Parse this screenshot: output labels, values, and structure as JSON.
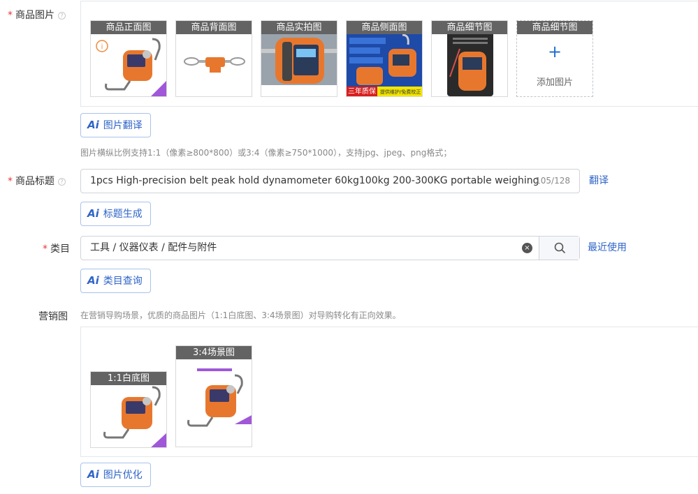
{
  "product_images": {
    "label": "商品图片",
    "required_mark": "*",
    "help_icon": "question-circle-icon",
    "cards": [
      {
        "caption": "商品正面图"
      },
      {
        "caption": "商品背面图"
      },
      {
        "caption": "商品实拍图"
      },
      {
        "caption": "商品侧面图"
      },
      {
        "caption": "商品细节图"
      }
    ],
    "add_card": {
      "caption": "商品细节图",
      "plus": "+",
      "text": "添加图片"
    },
    "ai_button": {
      "icon": "Ai",
      "label": "图片翻译"
    },
    "hint": "图片横纵比例支持1:1（像素≥800*800）或3:4（像素≥750*1000），支持jpg、jpeg、png格式；",
    "badges": {
      "side_bottom": "三年质保",
      "side_bottom_right": "提供维护/免费校正"
    }
  },
  "title_field": {
    "label": "商品标题",
    "required_mark": "*",
    "value": "1pcs High-precision belt peak hold dynamometer 60kg100kg 200-300KG portable weighing",
    "counter": "105/128",
    "translate_link": "翻译",
    "ai_button": {
      "icon": "Ai",
      "label": "标题生成"
    }
  },
  "category_field": {
    "label": "类目",
    "required_mark": "*",
    "value": "工具 / 仪器仪表 / 配件与附件",
    "clear_icon": "×",
    "recent_link": "最近使用",
    "ai_button": {
      "icon": "Ai",
      "label": "类目查询"
    }
  },
  "marketing": {
    "label": "营销图",
    "hint": "在营销导购场景，优质的商品图片（1:1白底图、3:4场景图）对导购转化有正向效果。",
    "cards": [
      {
        "caption": "1:1白底图"
      },
      {
        "caption": "3:4场景图"
      }
    ],
    "ai_button": {
      "icon": "Ai",
      "label": "图片优化"
    }
  },
  "colors": {
    "accent": "#2f64c8",
    "required": "#e4393c",
    "caption_bg": "#636363",
    "product_orange": "#e8772e"
  }
}
